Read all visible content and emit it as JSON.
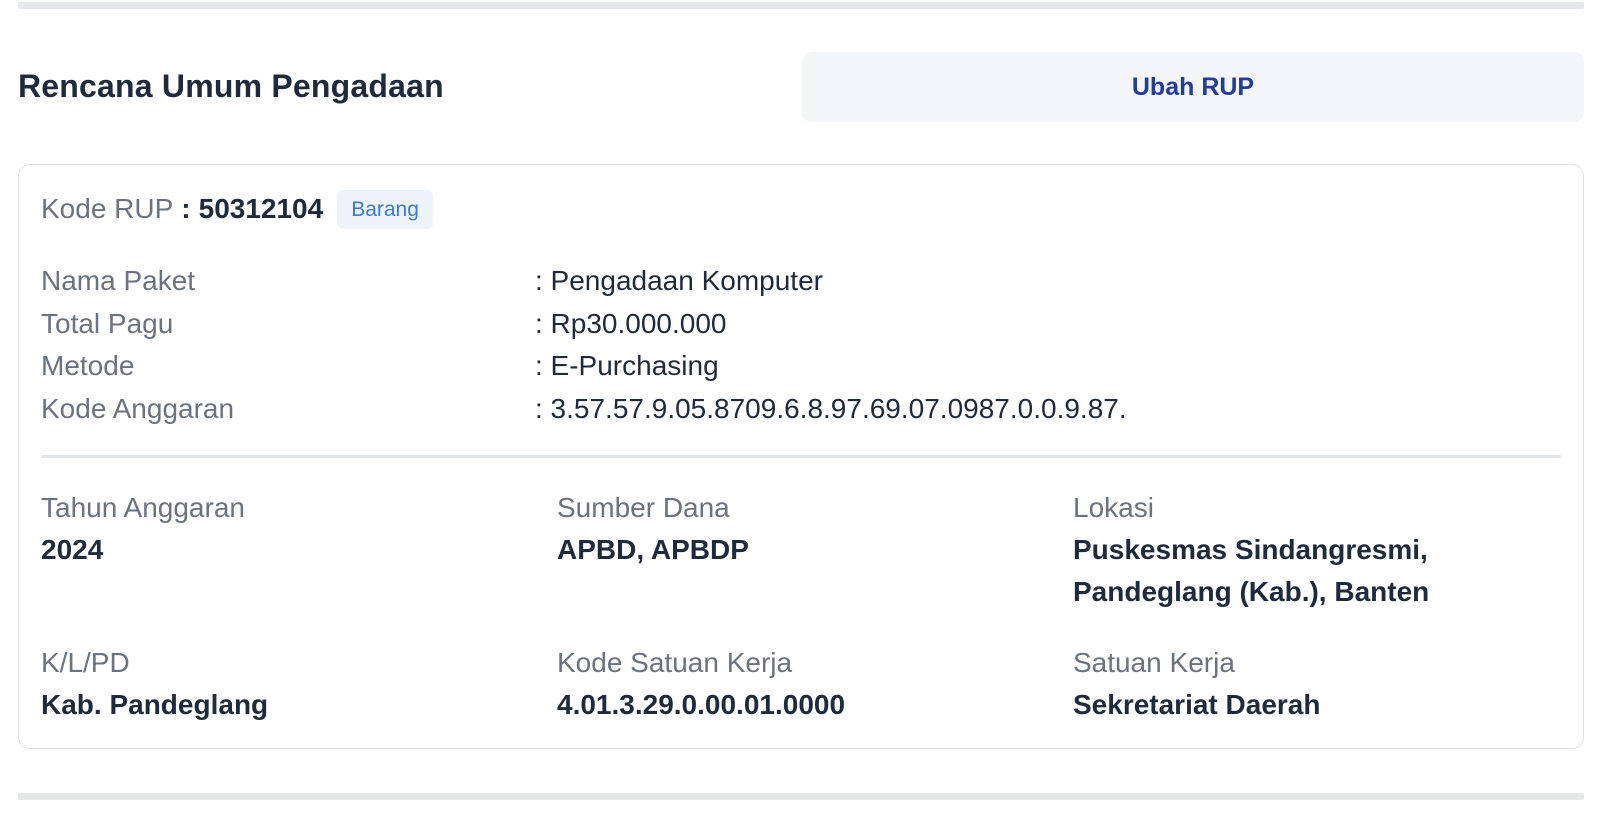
{
  "header": {
    "title": "Rencana Umum Pengadaan",
    "edit_button_label": "Ubah RUP"
  },
  "rup": {
    "kode_label": "Kode RUP",
    "kode_separator": ":",
    "kode_value": "50312104",
    "category_badge": "Barang",
    "info": [
      {
        "label": "Nama Paket",
        "value": ": Pengadaan Komputer"
      },
      {
        "label": "Total Pagu",
        "value": ": Rp30.000.000"
      },
      {
        "label": "Metode",
        "value": ": E-Purchasing"
      },
      {
        "label": "Kode Anggaran",
        "value": ": 3.57.57.9.05.8709.6.8.97.69.07.0987.0.0.9.87."
      }
    ],
    "details": [
      {
        "label": "Tahun Anggaran",
        "value": "2024"
      },
      {
        "label": "Sumber Dana",
        "value": "APBD, APBDP"
      },
      {
        "label": "Lokasi",
        "value": "Puskesmas Sindangresmi, Pandeglang (Kab.), Banten"
      },
      {
        "label": "K/L/PD",
        "value": "Kab. Pandeglang"
      },
      {
        "label": "Kode Satuan Kerja",
        "value": "4.01.3.29.0.00.01.0000"
      },
      {
        "label": "Satuan Kerja",
        "value": "Sekretariat Daerah"
      }
    ]
  },
  "colors": {
    "title_text": "#1f2a3d",
    "button_bg": "#f3f5f8",
    "button_text": "#243c9a",
    "badge_bg": "#eef3fb",
    "badge_text": "#3b7bd6",
    "muted_text": "#6b7280",
    "divider": "#e5e7eb"
  }
}
